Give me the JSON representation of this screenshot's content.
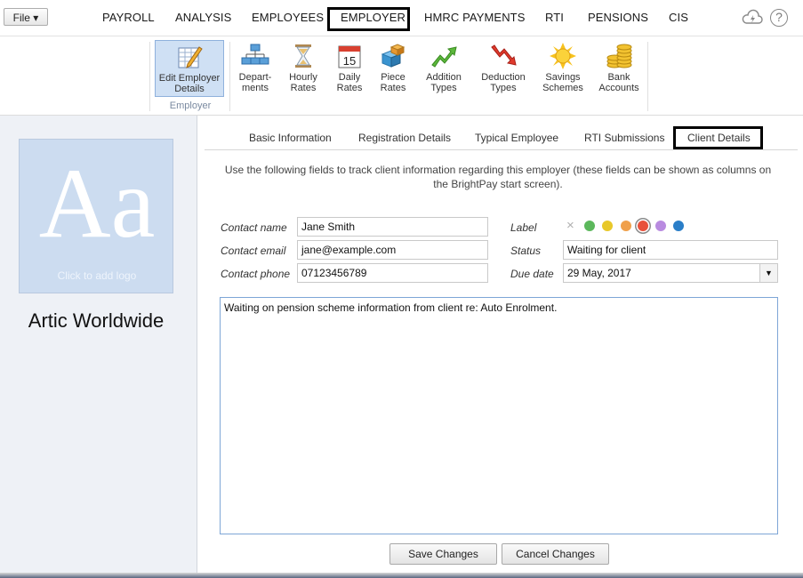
{
  "topbar": {
    "file_label": "File ▾",
    "nav": [
      "PAYROLL",
      "ANALYSIS",
      "EMPLOYEES",
      "EMPLOYER",
      "HMRC PAYMENTS",
      "RTI",
      "PENSIONS",
      "CIS"
    ],
    "active_nav": "EMPLOYER",
    "cloud_icon": "cloud-sync-icon",
    "help_label": "?"
  },
  "ribbon": {
    "buttons": [
      {
        "line1": "Edit Employer",
        "line2": "Details",
        "icon": "edit-details-icon"
      },
      {
        "line1": "Depart-",
        "line2": "ments",
        "icon": "departments-icon"
      },
      {
        "line1": "Hourly",
        "line2": "Rates",
        "icon": "hourglass-icon"
      },
      {
        "line1": "Daily",
        "line2": "Rates",
        "icon": "calendar-icon",
        "icon_text": "15"
      },
      {
        "line1": "Piece",
        "line2": "Rates",
        "icon": "cubes-icon"
      },
      {
        "line1": "Addition",
        "line2": "Types",
        "icon": "up-arrow-icon"
      },
      {
        "line1": "Deduction",
        "line2": "Types",
        "icon": "down-arrow-icon"
      },
      {
        "line1": "Savings",
        "line2": "Schemes",
        "icon": "sun-icon"
      },
      {
        "line1": "Bank",
        "line2": "Accounts",
        "icon": "coins-icon"
      }
    ],
    "group_label": "Employer"
  },
  "left": {
    "logo_letters": "Aa",
    "logo_hint": "Click to add logo",
    "employer_name": "Artic Worldwide"
  },
  "tabs": [
    "Basic Information",
    "Registration Details",
    "Typical Employee",
    "RTI Submissions",
    "Client Details"
  ],
  "active_tab": "Client Details",
  "hint_line1": "Use the following fields to track client information regarding this employer (these fields can be shown as columns on",
  "hint_line2": "the BrightPay start screen).",
  "form": {
    "contact_name_label": "Contact name",
    "contact_name": "Jane Smith",
    "contact_email_label": "Contact email",
    "contact_email": "jane@example.com",
    "contact_phone_label": "Contact phone",
    "contact_phone": "07123456789",
    "label_label": "Label",
    "label_clear": "×",
    "label_colors": [
      "#5cb85c",
      "#e8c82a",
      "#f0a04b",
      "#e8523c",
      "#b98be0",
      "#2a7ec8"
    ],
    "label_selected": "#e8523c",
    "status_label": "Status",
    "status": "Waiting for client",
    "due_date_label": "Due date",
    "due_date": "29 May, 2017",
    "notes": "Waiting on pension scheme information from client re: Auto Enrolment."
  },
  "buttons": {
    "save": "Save Changes",
    "cancel": "Cancel Changes"
  }
}
